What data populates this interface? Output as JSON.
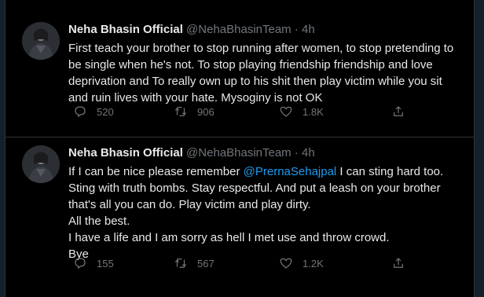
{
  "colors": {
    "background": "#000000",
    "text": "#e7e9ea",
    "muted": "#71767b",
    "link": "#1d9bf0",
    "border": "#2f3336"
  },
  "tweets": [
    {
      "author_name": "Neha Bhasin Official",
      "handle": "@NehaBhasinTeam",
      "separator": "·",
      "time": "4h",
      "text_lines": [
        "First teach your brother to stop running after women, to stop pretending to be single when he's not. To stop playing friendship friendship and love deprivation and To really own up to his shit then play victim while you sit and ruin lives with your hate. Mysoginy is not OK"
      ],
      "replies": "520",
      "retweets": "906",
      "likes": "1.8K"
    },
    {
      "author_name": "Neha Bhasin Official",
      "handle": "@NehaBhasinTeam",
      "separator": "·",
      "time": "4h",
      "text_before_mention": "If I can be nice please remember ",
      "mention": "@PrernaSehajpal",
      "text_after_mention": " I can sting hard too. Sting with truth bombs. Stay respectful. And put a leash on your brother that's all you can do. Play victim and play dirty.",
      "text_lines": [
        "All the best.",
        "I have a life and I am sorry as hell I met use and throw crowd.",
        "Bye"
      ],
      "replies": "155",
      "retweets": "567",
      "likes": "1.2K"
    }
  ],
  "icons": {
    "reply": "reply-icon",
    "retweet": "retweet-icon",
    "like": "heart-icon",
    "share": "share-icon"
  }
}
